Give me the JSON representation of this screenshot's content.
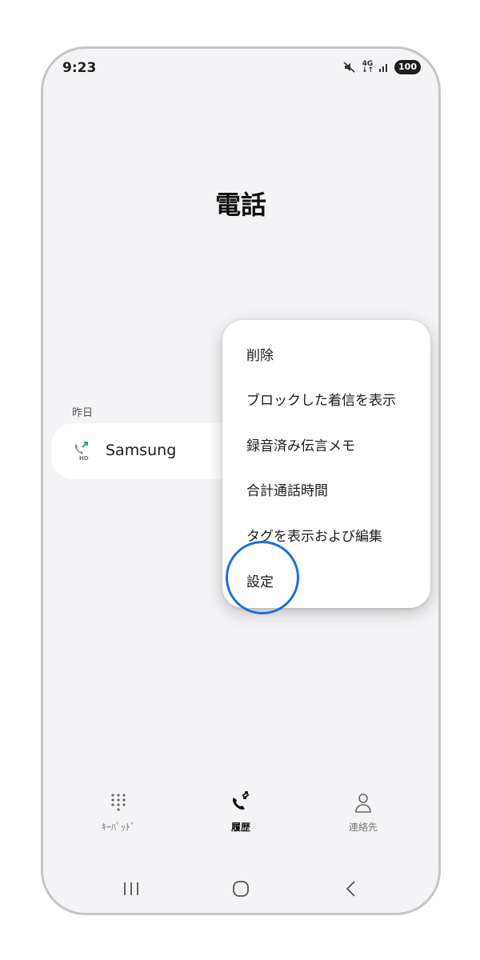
{
  "status_bar": {
    "time": "9:23",
    "network_top": "4G",
    "network_bottom": "↓↑",
    "battery": "100",
    "icons": [
      "mute-icon",
      "signal-icon"
    ]
  },
  "page_title": "電話",
  "recents": {
    "section_header": "昨日",
    "items": [
      {
        "name": "Samsung",
        "icon": "hd-outgoing-call-icon",
        "icon_badge": "HD"
      }
    ]
  },
  "menu": {
    "items": [
      {
        "label": "削除"
      },
      {
        "label": "ブロックした着信を表示"
      },
      {
        "label": "録音済み伝言メモ"
      },
      {
        "label": "合計通話時間"
      },
      {
        "label": "タグを表示および編集"
      },
      {
        "label": "設定"
      }
    ]
  },
  "bottom_nav": {
    "tabs": [
      {
        "label": "ｷｰﾊﾟｯﾄﾞ",
        "icon": "keypad-icon",
        "active": false
      },
      {
        "label": "履歴",
        "icon": "recents-icon",
        "active": true
      },
      {
        "label": "連絡先",
        "icon": "contacts-icon",
        "active": false
      }
    ]
  },
  "system_nav": [
    "recent-apps-icon",
    "home-icon",
    "back-icon"
  ],
  "colors": {
    "accent_ring": "#1f6fd9",
    "call_icon_green": "#1aa260",
    "background": "#f4f4f6"
  }
}
